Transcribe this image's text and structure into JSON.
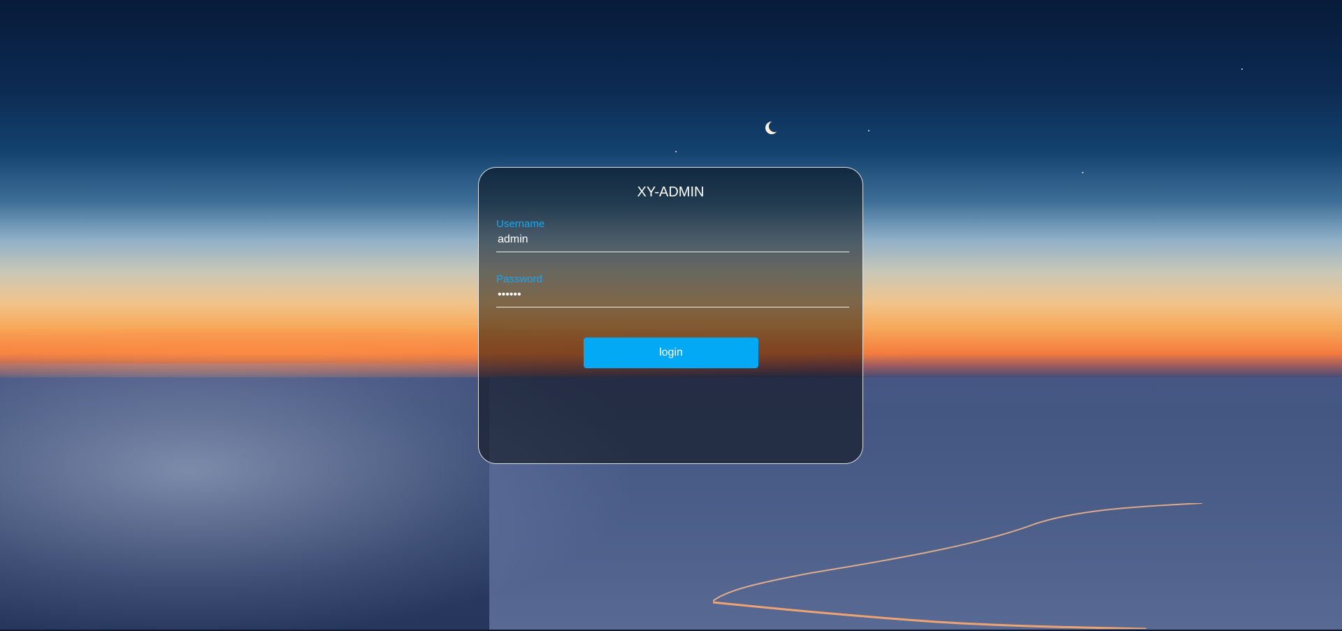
{
  "app": {
    "title": "XY-ADMIN"
  },
  "login_form": {
    "username": {
      "label": "Username",
      "value": "admin"
    },
    "password": {
      "label": "Password",
      "value": "••••••"
    },
    "submit_label": "login"
  },
  "colors": {
    "accent": "#03a9f4",
    "label": "#1aa7f2",
    "card_border": "#ffffff"
  }
}
